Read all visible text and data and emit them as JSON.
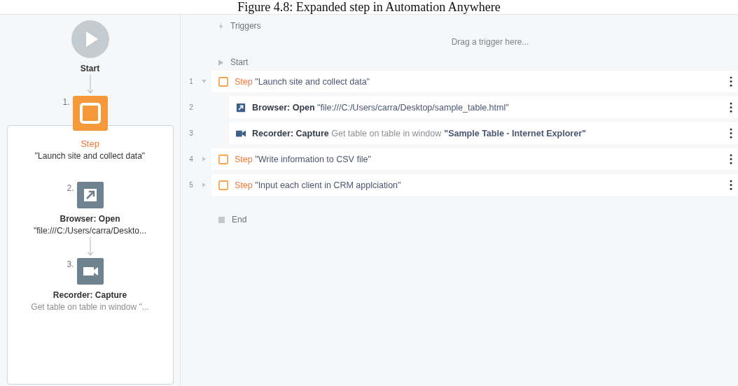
{
  "caption": "Figure 4.8: Expanded step in Automation Anywhere",
  "flow": {
    "start_label": "Start",
    "nodes": [
      {
        "number": "1.",
        "kind": "step",
        "title": "Step",
        "detail": "\"Launch site and collect data\"",
        "expanded": true,
        "children": [
          {
            "number": "2.",
            "kind": "browser",
            "title": "Browser: Open",
            "detail": "\"file:///C:/Users/carra/Deskto..."
          },
          {
            "number": "3.",
            "kind": "recorder",
            "title": "Recorder: Capture",
            "detail": "Get table on table in window \"..."
          }
        ]
      }
    ]
  },
  "list": {
    "triggers": {
      "label": "Triggers",
      "placeholder": "Drag a trigger here..."
    },
    "start_label": "Start",
    "rows": [
      {
        "number": "1",
        "kind": "step",
        "expanded": true,
        "keyword": "Step",
        "text": "\"Launch site and collect data\"",
        "children": [
          {
            "number": "2",
            "kind": "browser",
            "keyword": "Browser: Open",
            "text": "\"file:///C:/Users/carra/Desktop/sample_table.html\""
          },
          {
            "number": "3",
            "kind": "recorder",
            "keyword": "Recorder: Capture",
            "text": "Get table on table in window",
            "value": "\"Sample Table - Internet Explorer\""
          }
        ]
      },
      {
        "number": "4",
        "kind": "step",
        "expanded": false,
        "keyword": "Step",
        "text": "\"Write information to CSV file\""
      },
      {
        "number": "5",
        "kind": "step",
        "expanded": false,
        "keyword": "Step",
        "text": "\"Input each client in CRM applciation\""
      }
    ],
    "end_label": "End"
  }
}
